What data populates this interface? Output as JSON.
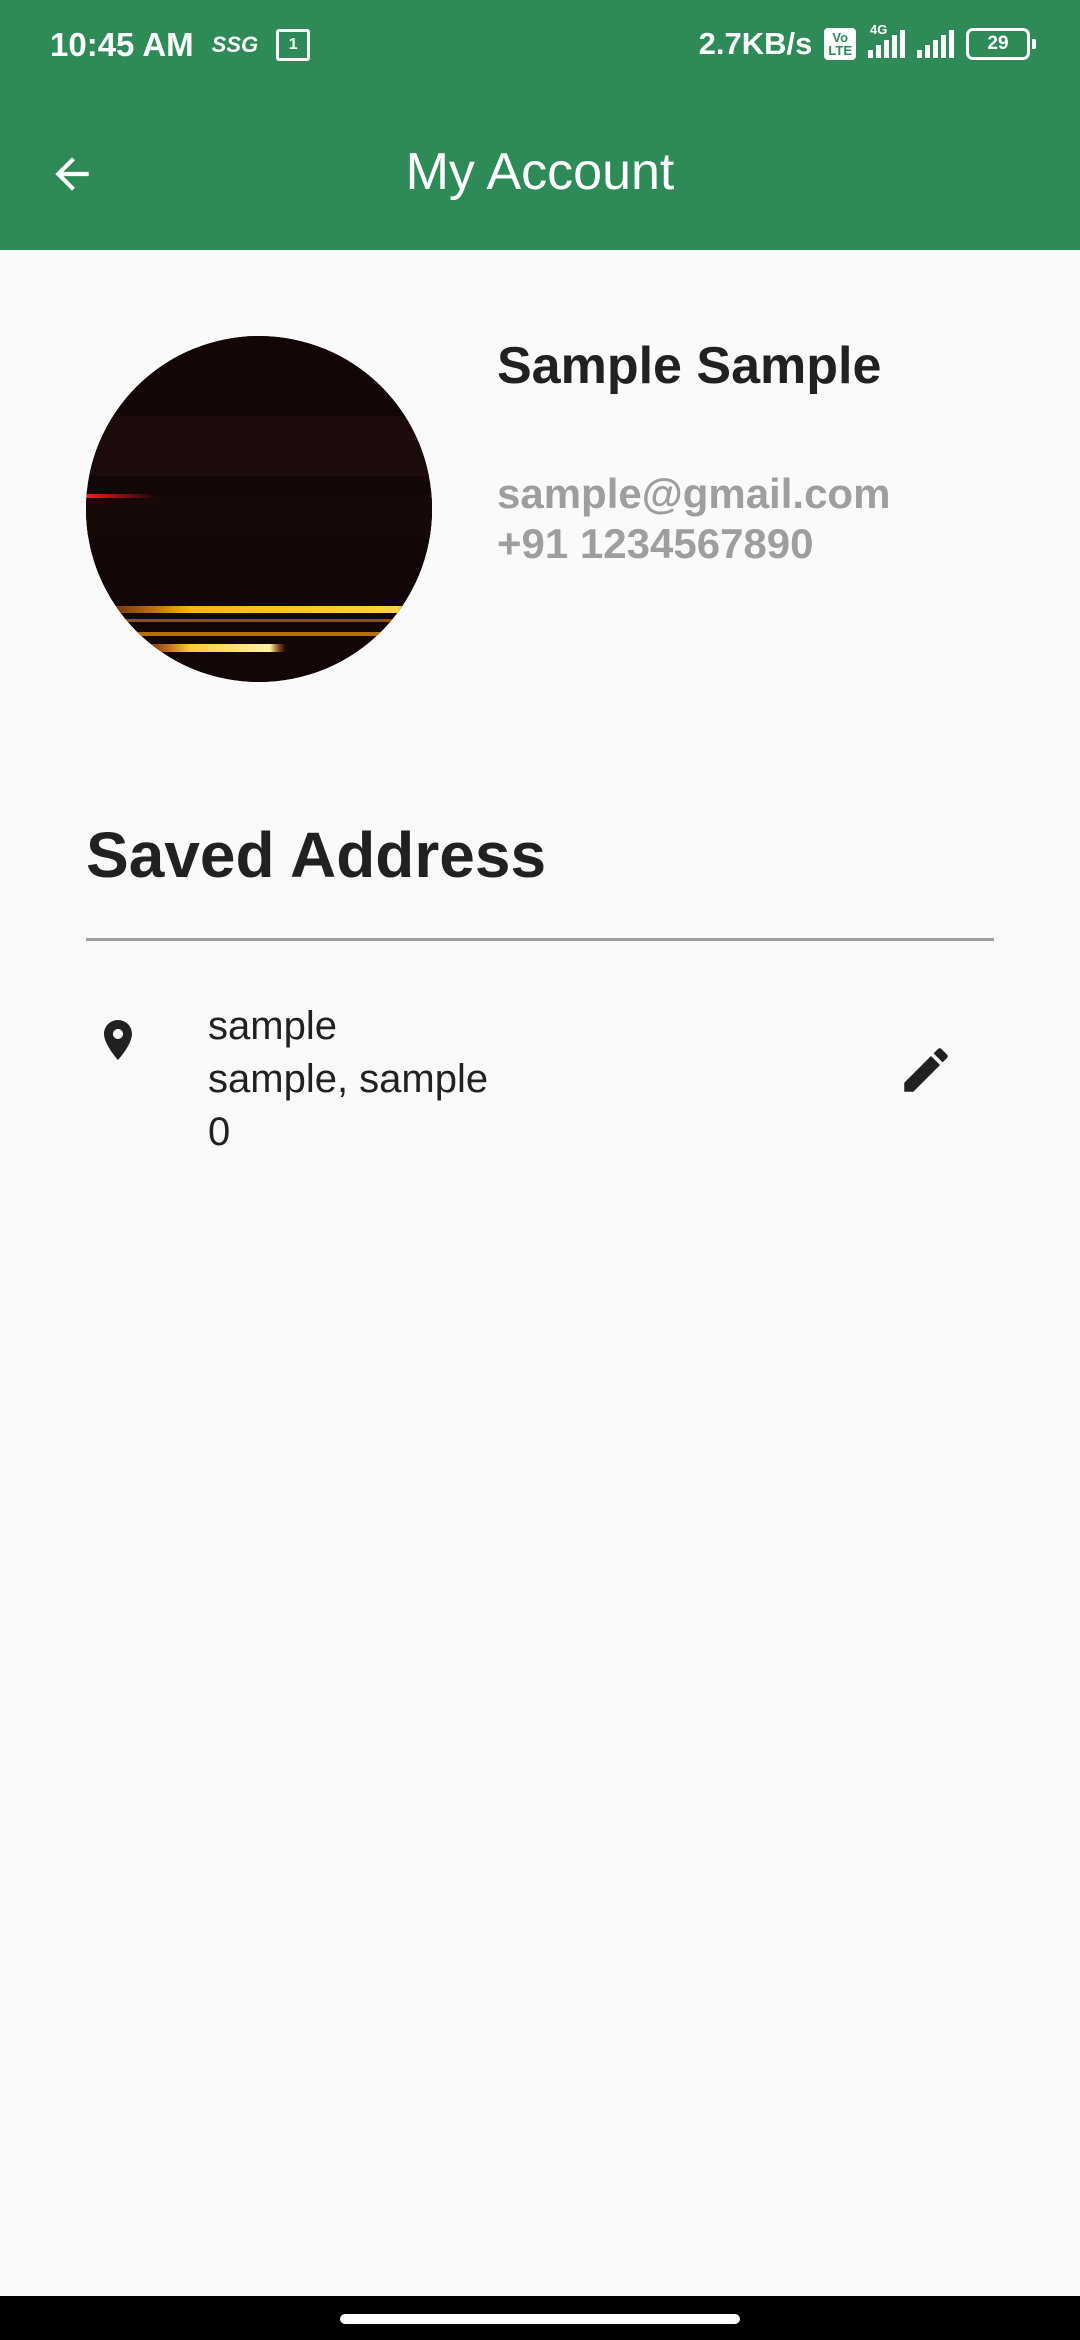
{
  "status_bar": {
    "time": "10:45 AM",
    "indicator_text": "SSG",
    "calendar_badge": "1",
    "network_speed": "2.7KB/s",
    "volte_label": "Vo\nLTE",
    "network_type": "4G",
    "battery_level": "29"
  },
  "app_bar": {
    "title": "My Account",
    "background_color": "#2e8b57",
    "back_icon": "arrow-back-icon"
  },
  "profile": {
    "name": "Sample Sample",
    "email": "sample@gmail.com",
    "phone": "+91 1234567890"
  },
  "saved_address": {
    "title": "Saved Address",
    "items": [
      {
        "line1": "sample",
        "line2": "sample, sample",
        "line3": "0",
        "icon": "location-pin-icon",
        "action_icon": "edit-pencil-icon"
      }
    ]
  }
}
